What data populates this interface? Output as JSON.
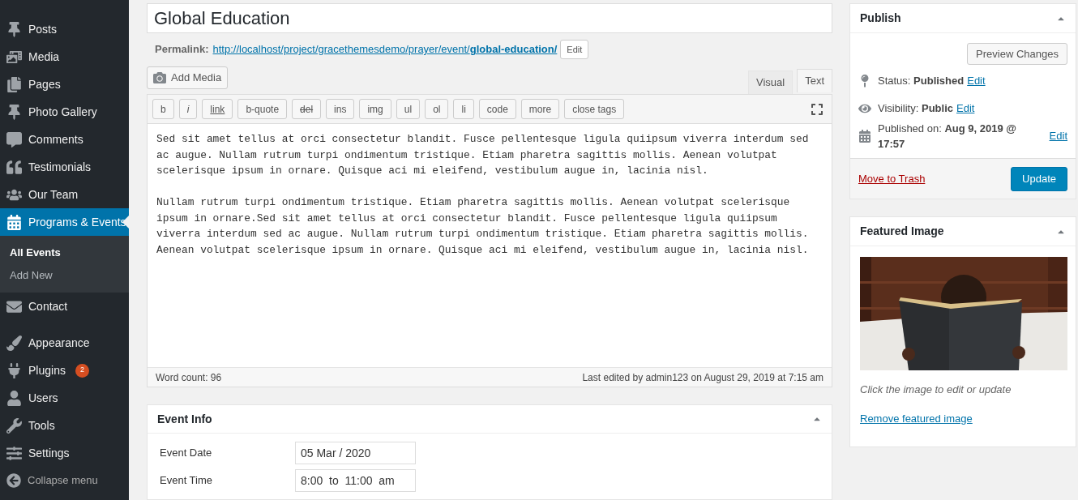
{
  "sidebar": {
    "items": [
      {
        "label": "Posts",
        "selected": false
      },
      {
        "label": "Media",
        "selected": false
      },
      {
        "label": "Pages",
        "selected": false
      },
      {
        "label": "Photo Gallery",
        "selected": false
      },
      {
        "label": "Comments",
        "selected": false
      },
      {
        "label": "Testimonials",
        "selected": false
      },
      {
        "label": "Our Team",
        "selected": false
      },
      {
        "label": "Programs & Events",
        "selected": true,
        "children": [
          {
            "label": "All Events",
            "selected": true
          },
          {
            "label": "Add New",
            "selected": false
          }
        ]
      },
      {
        "label": "Contact",
        "selected": false
      },
      {
        "label": "Appearance",
        "selected": false
      },
      {
        "label": "Plugins",
        "selected": false,
        "badge": "2"
      },
      {
        "label": "Users",
        "selected": false
      },
      {
        "label": "Tools",
        "selected": false
      },
      {
        "label": "Settings",
        "selected": false
      }
    ],
    "collapse": "Collapse menu"
  },
  "title": "Global Education",
  "permalink": {
    "label": "Permalink:",
    "url": "http://localhost/project/gracethemesdemo/prayer/event/",
    "slug": "global-education/",
    "button": "Edit"
  },
  "editor": {
    "add_media": "Add Media",
    "tabs": [
      {
        "label": "Visual",
        "selected": false
      },
      {
        "label": "Text",
        "selected": true
      }
    ],
    "toolbar": [
      "b",
      "i",
      "link",
      "b-quote",
      "del",
      "ins",
      "img",
      "ul",
      "ol",
      "li",
      "code",
      "more",
      "close tags"
    ],
    "paragraphs": [
      "Sed sit amet tellus at orci consectetur blandit. Fusce pellentesque ligula quiipsum viverra interdum sed ac augue. Nullam rutrum turpi ondimentum tristique. Etiam pharetra sagittis mollis. Aenean volutpat scelerisque ipsum in ornare. Quisque aci mi eleifend, vestibulum augue in, lacinia nisl.",
      "Nullam rutrum turpi ondimentum tristique. Etiam pharetra sagittis mollis. Aenean volutpat scelerisque ipsum in ornare.Sed sit amet tellus at orci consectetur blandit. Fusce pellentesque ligula quiipsum viverra interdum sed ac augue. Nullam rutrum turpi ondimentum tristique. Etiam pharetra sagittis mollis. Aenean volutpat scelerisque ipsum in ornare. Quisque aci mi eleifend, vestibulum augue in, lacinia nisl."
    ],
    "word_count": "Word count: 96",
    "last_edited": "Last edited by admin123 on August 29, 2019 at 7:15 am"
  },
  "event_info": {
    "title": "Event Info",
    "fields": [
      {
        "label": "Event Date",
        "value": "05 Mar / 2020"
      },
      {
        "label": "Event Time",
        "value": "8:00  to  11:00  am"
      }
    ]
  },
  "publish": {
    "title": "Publish",
    "preview": "Preview Changes",
    "rows": [
      {
        "label": "Status:",
        "value": "Published",
        "link": "Edit"
      },
      {
        "label": "Visibility:",
        "value": "Public",
        "link": "Edit"
      },
      {
        "label": "Published on:",
        "value": "Aug 9, 2019 @ 17:57",
        "link": "Edit"
      }
    ],
    "trash": "Move to Trash",
    "update": "Update"
  },
  "featured_image": {
    "title": "Featured Image",
    "hint": "Click the image to edit or update",
    "remove": "Remove featured image"
  }
}
